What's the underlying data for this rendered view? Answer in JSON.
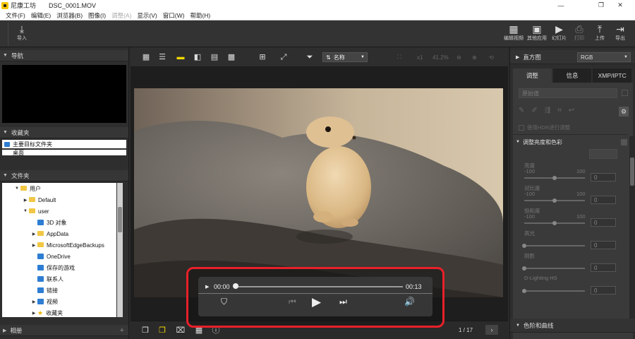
{
  "window": {
    "app_name": "尼康工坊",
    "file_name": "DSC_0001.MOV",
    "controls": [
      "—",
      "❐",
      "✕"
    ]
  },
  "menu": [
    {
      "label": "文件(F)",
      "disabled": false
    },
    {
      "label": "编辑(E)",
      "disabled": false
    },
    {
      "label": "浏览器(B)",
      "disabled": false
    },
    {
      "label": "图像(I)",
      "disabled": false
    },
    {
      "label": "调整(A)",
      "disabled": true
    },
    {
      "label": "显示(V)",
      "disabled": false
    },
    {
      "label": "窗口(W)",
      "disabled": false
    },
    {
      "label": "帮助(H)",
      "disabled": false
    }
  ],
  "toolbar": {
    "import_label": "导入",
    "edit_video_label": "编辑视频",
    "other_apps_label": "其他应用",
    "slideshow_label": "幻灯片",
    "print_label": "打印",
    "upload_label": "上传",
    "export_label": "导出"
  },
  "left_panel": {
    "navigation_title": "导航",
    "favorites_title": "收藏夹",
    "favorites_item": "主要目标文件夹",
    "desktop_partial": "桌面",
    "folders_title": "文件夹",
    "tree": [
      {
        "indent": 1,
        "icon": "folder",
        "expand": "▼",
        "label": "用户"
      },
      {
        "indent": 2,
        "icon": "folder",
        "expand": "▶",
        "label": "Default"
      },
      {
        "indent": 2,
        "icon": "folder",
        "expand": "▼",
        "label": "user"
      },
      {
        "indent": 3,
        "icon": "blue",
        "expand": "",
        "label": "3D 对象"
      },
      {
        "indent": 3,
        "icon": "folder",
        "expand": "▶",
        "label": "AppData"
      },
      {
        "indent": 3,
        "icon": "folder",
        "expand": "▶",
        "label": "MicrosoftEdgeBackups"
      },
      {
        "indent": 3,
        "icon": "blue",
        "expand": "",
        "label": "OneDrive"
      },
      {
        "indent": 3,
        "icon": "blue",
        "expand": "",
        "label": "保存的游戏"
      },
      {
        "indent": 3,
        "icon": "blue",
        "expand": "",
        "label": "联系人"
      },
      {
        "indent": 3,
        "icon": "blue",
        "expand": "",
        "label": "链接"
      },
      {
        "indent": 3,
        "icon": "blue",
        "expand": "▶",
        "label": "视频"
      },
      {
        "indent": 3,
        "icon": "star",
        "expand": "▶",
        "label": "收藏夹"
      }
    ],
    "album_title": "相册"
  },
  "center": {
    "sort_label": "名称",
    "zoom_level": "41.2%",
    "zoom_x1": "x1",
    "page_counter": "1 / 17"
  },
  "player": {
    "current_time": "00:00",
    "total_time": "00:13",
    "progress_fraction": 0.0
  },
  "right_panel": {
    "histogram_title": "直方图",
    "histogram_channel": "RGB",
    "tabs": [
      "调整",
      "信息",
      "XMP/IPTC"
    ],
    "preset_select": "原始值",
    "hdr_label": "使用HDR进行调整",
    "group_brightness": "调整亮度和色彩",
    "sliders": [
      {
        "label": "亮度",
        "min": "-100",
        "max": "100",
        "value": "0",
        "fraction": 0.5
      },
      {
        "label": "对比度",
        "min": "-100",
        "max": "100",
        "value": "0",
        "fraction": 0.5
      },
      {
        "label": "饱和度",
        "min": "-100",
        "max": "100",
        "value": "0",
        "fraction": 0.5
      },
      {
        "label": "高光",
        "min": "",
        "max": "",
        "value": "0",
        "fraction": 0.0
      },
      {
        "label": "阴影",
        "min": "",
        "max": "",
        "value": "0",
        "fraction": 0.0
      },
      {
        "label": "D-Lighting HS",
        "min": "",
        "max": "",
        "value": "0",
        "fraction": 0.0
      }
    ],
    "group_levels": "色阶和曲线"
  }
}
